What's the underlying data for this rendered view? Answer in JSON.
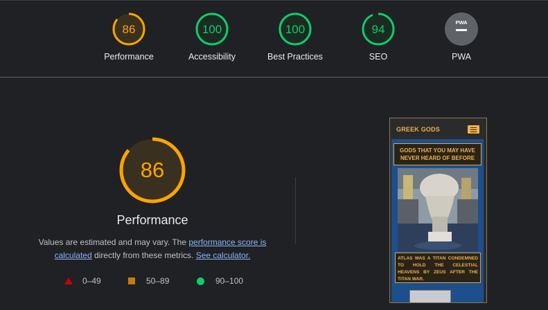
{
  "summary": [
    {
      "id": "perf",
      "score": "86",
      "label": "Performance",
      "value": 86,
      "color": "#ffa400"
    },
    {
      "id": "a11y",
      "score": "100",
      "label": "Accessibility",
      "value": 100,
      "color": "#0cce6b"
    },
    {
      "id": "bp",
      "score": "100",
      "label": "Best Practices",
      "value": 100,
      "color": "#0cce6b"
    },
    {
      "id": "seo",
      "score": "94",
      "label": "SEO",
      "value": 94,
      "color": "#0cce6b"
    },
    {
      "id": "pwa",
      "score": "PWA",
      "label": "PWA",
      "value": null,
      "color": "#9aa0a6"
    }
  ],
  "performance": {
    "score": "86",
    "value": 86,
    "title": "Performance",
    "desc_before": "Values are estimated and may vary. The ",
    "desc_link1": "performance score is calculated",
    "desc_middle": " directly from these metrics. ",
    "desc_link2": "See calculator."
  },
  "legend": {
    "fail": "0–49",
    "average": "50–89",
    "pass": "90–100"
  },
  "screenshot": {
    "site_title": "GREEK GODS",
    "heading": "GODS THAT YOU MAY HAVE NEVER HEARD OF BEFORE",
    "caption": "ATLAS WAS A TITAN CONDEMNED TO HOLD THE CELESTIAL HEAVENS BY ZEUS AFTER THE TITAN WAR."
  },
  "colors": {
    "background": "#202124",
    "average": "#ffa400",
    "pass": "#0cce6b",
    "fail": "#cc0000",
    "link": "#8ab4f8",
    "site_accent": "#f0b050"
  }
}
